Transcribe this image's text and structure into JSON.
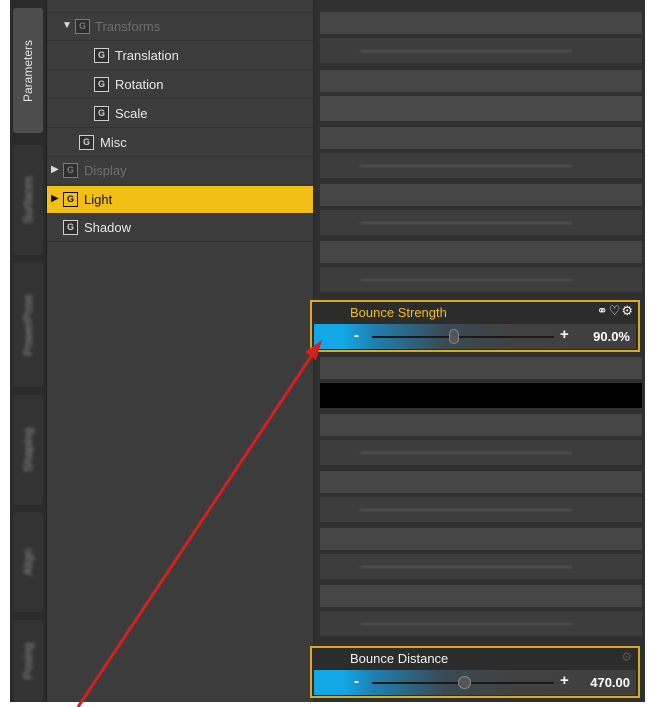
{
  "vertical_tabs": [
    {
      "label": "Parameters",
      "active": true
    },
    {
      "label": "Surfaces",
      "active": false
    },
    {
      "label": "PowerPose",
      "active": false
    },
    {
      "label": "Shaping",
      "active": false
    },
    {
      "label": "Align",
      "active": false
    },
    {
      "label": "Posing",
      "active": false
    }
  ],
  "tree": {
    "items": [
      {
        "label": "Transforms",
        "icon": "group-icon",
        "expanded": true,
        "dim": true
      },
      {
        "label": "Translation",
        "icon": "group-icon"
      },
      {
        "label": "Rotation",
        "icon": "group-icon"
      },
      {
        "label": "Scale",
        "icon": "group-icon"
      },
      {
        "label": "Misc",
        "icon": "group-icon"
      },
      {
        "label": "Display",
        "icon": "group-icon",
        "collapsed": true,
        "dim": true
      },
      {
        "label": "Light",
        "icon": "group-icon",
        "collapsed": true,
        "selected": true
      },
      {
        "label": "Shadow",
        "icon": "group-icon"
      }
    ]
  },
  "properties": {
    "bounce_strength": {
      "label": "Bounce Strength",
      "value": "90.0%",
      "level": 0.9,
      "minus": "-",
      "plus": "+",
      "icons": [
        "link-icon",
        "heart-icon",
        "gear-icon"
      ]
    },
    "bounce_distance": {
      "label": "Bounce Distance",
      "value": "470.00",
      "minus": "-",
      "plus": "+",
      "icons": [
        "gear-icon"
      ]
    }
  },
  "colors": {
    "accent": "#f2bf14",
    "slider_fill": "#12a8e8",
    "annotation_arrow": "#d42020"
  }
}
